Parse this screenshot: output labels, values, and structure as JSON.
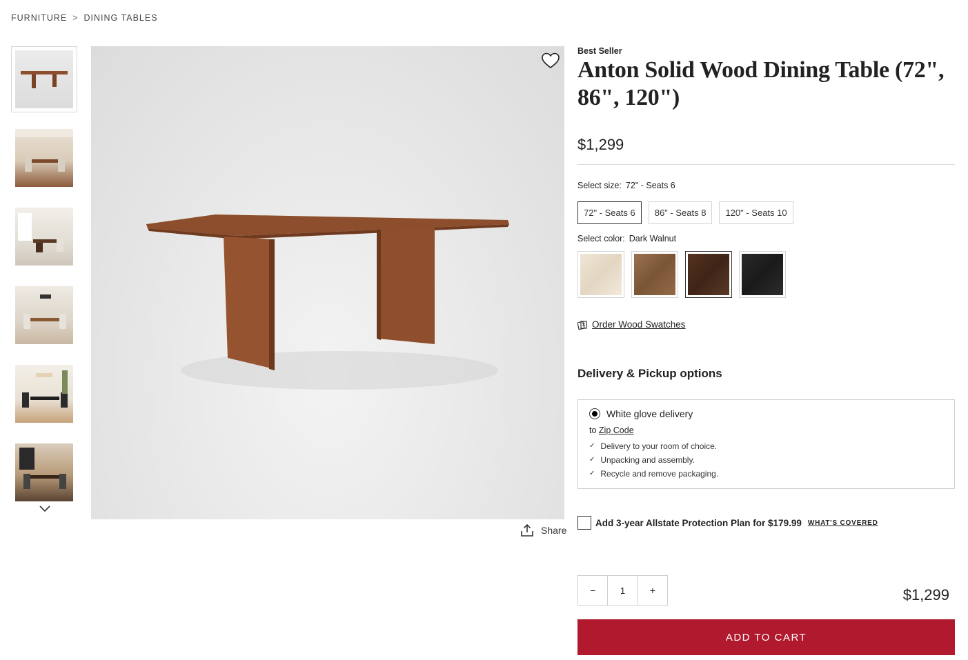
{
  "breadcrumb": {
    "items": [
      "FURNITURE",
      "DINING TABLES"
    ],
    "separator": ">"
  },
  "gallery": {
    "thumbnails": [
      "table-studio",
      "dining-room-1",
      "dining-room-2",
      "dining-room-3",
      "dining-room-4",
      "dining-room-5"
    ],
    "icons": {
      "favorite": "heart-icon",
      "share": "share-icon",
      "more": "chevron-down-icon"
    },
    "share_label": "Share"
  },
  "product": {
    "badge": "Best Seller",
    "title": "Anton Solid Wood Dining Table (72\", 86\", 120\")",
    "price": "$1,299"
  },
  "size": {
    "label": "Select size:",
    "selected": "72\" - Seats 6",
    "options": [
      "72\" - Seats 6",
      "86\" - Seats 8",
      "120\" - Seats 10"
    ]
  },
  "color": {
    "label": "Select color:",
    "selected": "Dark Walnut",
    "swatch_colors": [
      "#e9dfcf",
      "#8a6443",
      "#4b2e20",
      "#222222"
    ]
  },
  "swatches_link": "Order Wood Swatches",
  "delivery": {
    "heading": "Delivery & Pickup options",
    "option": "White glove delivery",
    "to": "to",
    "zip_link": "Zip Code",
    "benefits": [
      "Delivery to your room of choice.",
      "Unpacking and assembly.",
      "Recycle and remove packaging."
    ]
  },
  "protection": {
    "text": "Add 3-year Allstate Protection Plan for $179.99",
    "link": "WHAT'S COVERED"
  },
  "quantity": {
    "minus": "−",
    "value": "1",
    "plus": "+"
  },
  "total": "$1,299",
  "cta": "ADD TO CART",
  "colors": {
    "accent": "#b0192e",
    "wood": "#8c4e2c"
  }
}
